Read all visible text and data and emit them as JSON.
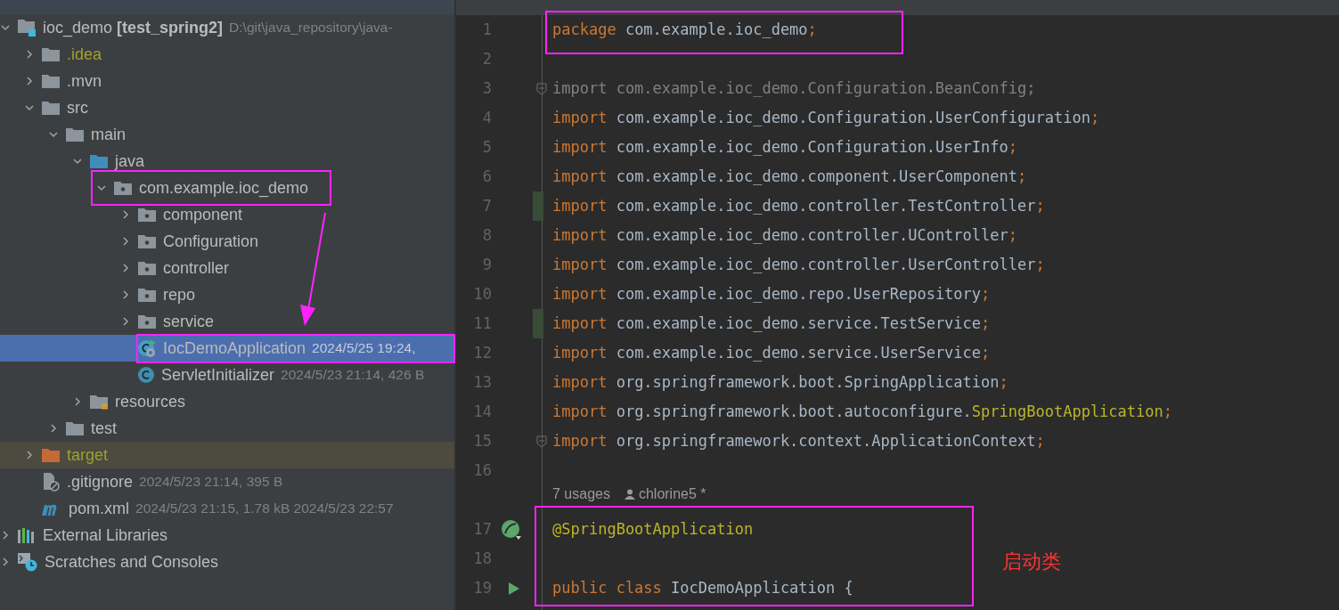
{
  "project_tree": [
    {
      "kind": "module",
      "label": "ioc_demo **[test_spring2]**",
      "meta": "D:\\git\\java_repository\\java-",
      "expanded": true,
      "selected": false,
      "children": [
        {
          "kind": "ignored-folder",
          "label": ".idea",
          "expanded": false,
          "selected": false
        },
        {
          "kind": "folder",
          "label": ".mvn",
          "expanded": false,
          "selected": false
        },
        {
          "kind": "folder",
          "label": "src",
          "expanded": true,
          "selected": false,
          "children": [
            {
              "kind": "folder",
              "label": "main",
              "expanded": true,
              "selected": false,
              "children": [
                {
                  "kind": "source-root",
                  "label": "java",
                  "expanded": true,
                  "selected": false,
                  "children": [
                    {
                      "kind": "package",
                      "label": "com.example.ioc_demo",
                      "expanded": true,
                      "selected": false,
                      "children": [
                        {
                          "kind": "package",
                          "label": "component",
                          "expanded": false,
                          "selected": false
                        },
                        {
                          "kind": "package",
                          "label": "Configuration",
                          "expanded": false,
                          "selected": false
                        },
                        {
                          "kind": "package",
                          "label": "controller",
                          "expanded": false,
                          "selected": false
                        },
                        {
                          "kind": "package",
                          "label": "repo",
                          "expanded": false,
                          "selected": false
                        },
                        {
                          "kind": "package",
                          "label": "service",
                          "expanded": false,
                          "selected": false
                        },
                        {
                          "kind": "spring-class",
                          "label": "IocDemoApplication",
                          "meta": "2024/5/25 19:24,",
                          "selected": true
                        },
                        {
                          "kind": "class",
                          "label": "ServletInitializer",
                          "meta": "2024/5/23 21:14, 426 B",
                          "selected": false
                        }
                      ]
                    }
                  ]
                },
                {
                  "kind": "resources-root",
                  "label": "resources",
                  "expanded": false,
                  "selected": false
                }
              ]
            },
            {
              "kind": "folder",
              "label": "test",
              "expanded": false,
              "selected": false
            }
          ]
        },
        {
          "kind": "excluded-folder",
          "label": "target",
          "expanded": false,
          "selected": false
        },
        {
          "kind": "gitignore",
          "label": ".gitignore",
          "meta": "2024/5/23 21:14, 395 B",
          "selected": false
        },
        {
          "kind": "maven",
          "label": "pom.xml",
          "meta": "2024/5/23 21:15, 1.78 kB 2024/5/23 22:57",
          "selected": false
        }
      ]
    },
    {
      "kind": "libraries",
      "label": "External Libraries",
      "expanded": false,
      "selected": false
    },
    {
      "kind": "scratches",
      "label": "Scratches and Consoles",
      "expanded": false,
      "selected": false
    }
  ],
  "editor": {
    "lines": [
      {
        "kind": "code",
        "number": "1",
        "tokens": [
          {
            "kind": "keyword",
            "text": "package "
          },
          {
            "kind": "plain",
            "text": "com.example.ioc_demo"
          },
          {
            "kind": "punct",
            "text": ";"
          }
        ]
      },
      {
        "kind": "code",
        "number": "2"
      },
      {
        "kind": "code",
        "number": "3",
        "gutter": {
          "kind": "fold"
        },
        "tokens": [
          {
            "kind": "unused",
            "text": "import com.example.ioc_demo.Configuration.BeanConfig;"
          }
        ]
      },
      {
        "kind": "code",
        "number": "4",
        "tokens": [
          {
            "kind": "keyword",
            "text": "import "
          },
          {
            "kind": "plain",
            "text": "com.example.ioc_demo.Configuration.UserConfiguration"
          },
          {
            "kind": "punct",
            "text": ";"
          }
        ]
      },
      {
        "kind": "code",
        "number": "5",
        "tokens": [
          {
            "kind": "keyword",
            "text": "import "
          },
          {
            "kind": "plain",
            "text": "com.example.ioc_demo.Configuration.UserInfo"
          },
          {
            "kind": "punct",
            "text": ";"
          }
        ]
      },
      {
        "kind": "code",
        "number": "6",
        "tokens": [
          {
            "kind": "keyword",
            "text": "import "
          },
          {
            "kind": "plain",
            "text": "com.example.ioc_demo.component.UserComponent"
          },
          {
            "kind": "punct",
            "text": ";"
          }
        ]
      },
      {
        "kind": "code",
        "number": "7",
        "gutter": {
          "kind": "changed"
        },
        "tokens": [
          {
            "kind": "keyword",
            "text": "import "
          },
          {
            "kind": "plain",
            "text": "com.example.ioc_demo.controller.TestController"
          },
          {
            "kind": "punct",
            "text": ";"
          }
        ]
      },
      {
        "kind": "code",
        "number": "8",
        "tokens": [
          {
            "kind": "keyword",
            "text": "import "
          },
          {
            "kind": "plain",
            "text": "com.example.ioc_demo.controller.UController"
          },
          {
            "kind": "punct",
            "text": ";"
          }
        ]
      },
      {
        "kind": "code",
        "number": "9",
        "tokens": [
          {
            "kind": "keyword",
            "text": "import "
          },
          {
            "kind": "plain",
            "text": "com.example.ioc_demo.controller.UserController"
          },
          {
            "kind": "punct",
            "text": ";"
          }
        ]
      },
      {
        "kind": "code",
        "number": "10",
        "tokens": [
          {
            "kind": "keyword",
            "text": "import "
          },
          {
            "kind": "plain",
            "text": "com.example.ioc_demo.repo.UserRepository"
          },
          {
            "kind": "punct",
            "text": ";"
          }
        ]
      },
      {
        "kind": "code",
        "number": "11",
        "gutter": {
          "kind": "changed"
        },
        "tokens": [
          {
            "kind": "keyword",
            "text": "import "
          },
          {
            "kind": "plain",
            "text": "com.example.ioc_demo.service.TestService"
          },
          {
            "kind": "punct",
            "text": ";"
          }
        ]
      },
      {
        "kind": "code",
        "number": "12",
        "tokens": [
          {
            "kind": "keyword",
            "text": "import "
          },
          {
            "kind": "plain",
            "text": "com.example.ioc_demo.service.UserService"
          },
          {
            "kind": "punct",
            "text": ";"
          }
        ]
      },
      {
        "kind": "code",
        "number": "13",
        "tokens": [
          {
            "kind": "keyword",
            "text": "import "
          },
          {
            "kind": "plain",
            "text": "org.springframework.boot.SpringApplication"
          },
          {
            "kind": "punct",
            "text": ";"
          }
        ]
      },
      {
        "kind": "code",
        "number": "14",
        "tokens": [
          {
            "kind": "keyword",
            "text": "import "
          },
          {
            "kind": "plain",
            "text": "org.springframework.boot.autoconfigure."
          },
          {
            "kind": "annotation",
            "text": "SpringBootApplication"
          },
          {
            "kind": "punct",
            "text": ";"
          }
        ]
      },
      {
        "kind": "code",
        "number": "15",
        "gutter": {
          "kind": "fold"
        },
        "tokens": [
          {
            "kind": "keyword",
            "text": "import "
          },
          {
            "kind": "plain",
            "text": "org.springframework.context.ApplicationContext"
          },
          {
            "kind": "punct",
            "text": ";"
          }
        ]
      },
      {
        "kind": "code",
        "number": "16"
      },
      {
        "kind": "inlay",
        "usages": "7 usages",
        "author": "chlorine5 *"
      },
      {
        "kind": "code",
        "number": "17",
        "gutter": {
          "kind": "bean"
        },
        "tokens": [
          {
            "kind": "annotation",
            "text": "@SpringBootApplication"
          }
        ]
      },
      {
        "kind": "code",
        "number": "18"
      },
      {
        "kind": "code",
        "number": "19",
        "gutter": {
          "kind": "run"
        },
        "tokens": [
          {
            "kind": "keyword",
            "text": "public class "
          },
          {
            "kind": "plain",
            "text": "IocDemoApplication {"
          }
        ]
      }
    ]
  },
  "annotation": {
    "label": "启动类"
  }
}
